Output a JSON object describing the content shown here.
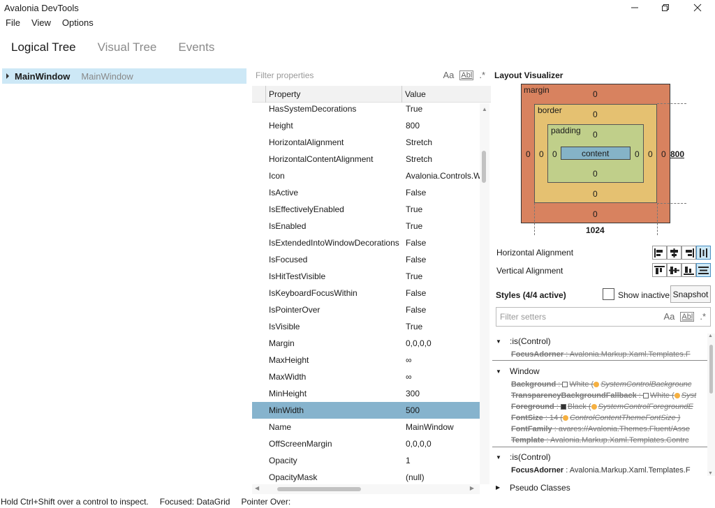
{
  "window": {
    "title": "Avalonia DevTools"
  },
  "menu": [
    "File",
    "View",
    "Options"
  ],
  "tabs": [
    "Logical Tree",
    "Visual Tree",
    "Events"
  ],
  "tree": {
    "node_name": "MainWindow",
    "node_type": "MainWindow"
  },
  "props": {
    "filter_placeholder": "Filter properties",
    "col_property": "Property",
    "col_value": "Value",
    "icon_case": "Aa",
    "icon_word": "Abl",
    "icon_regex": ".*",
    "rows": [
      {
        "name": "HasSystemDecorations",
        "value": "True"
      },
      {
        "name": "Height",
        "value": "800"
      },
      {
        "name": "HorizontalAlignment",
        "value": "Stretch"
      },
      {
        "name": "HorizontalContentAlignment",
        "value": "Stretch"
      },
      {
        "name": "Icon",
        "value": "Avalonia.Controls.W"
      },
      {
        "name": "IsActive",
        "value": "False"
      },
      {
        "name": "IsEffectivelyEnabled",
        "value": "True"
      },
      {
        "name": "IsEnabled",
        "value": "True"
      },
      {
        "name": "IsExtendedIntoWindowDecorations",
        "value": "False"
      },
      {
        "name": "IsFocused",
        "value": "False"
      },
      {
        "name": "IsHitTestVisible",
        "value": "True"
      },
      {
        "name": "IsKeyboardFocusWithin",
        "value": "False"
      },
      {
        "name": "IsPointerOver",
        "value": "False"
      },
      {
        "name": "IsVisible",
        "value": "True"
      },
      {
        "name": "Margin",
        "value": "0,0,0,0"
      },
      {
        "name": "MaxHeight",
        "value": "∞"
      },
      {
        "name": "MaxWidth",
        "value": "∞"
      },
      {
        "name": "MinHeight",
        "value": "300"
      },
      {
        "name": "MinWidth",
        "value": "500",
        "selected": true
      },
      {
        "name": "Name",
        "value": "MainWindow"
      },
      {
        "name": "OffScreenMargin",
        "value": "0,0,0,0"
      },
      {
        "name": "Opacity",
        "value": "1"
      },
      {
        "name": "OpacityMask",
        "value": "(null)"
      }
    ]
  },
  "layout": {
    "title": "Layout Visualizer",
    "margin_label": "margin",
    "border_label": "border",
    "padding_label": "padding",
    "content_label": "content",
    "margin": {
      "top": "0",
      "right": "0",
      "bottom": "0",
      "left": "0"
    },
    "border": {
      "top": "0",
      "right": "0",
      "bottom": "0",
      "left": "0"
    },
    "padding": {
      "top": "0",
      "right": "0",
      "bottom": "0",
      "left": "0"
    },
    "height": "800",
    "width": "1024",
    "horizontal_alignment_label": "Horizontal Alignment",
    "vertical_alignment_label": "Vertical Alignment",
    "horizontal_alignment_selected": "stretch",
    "vertical_alignment_selected": "stretch"
  },
  "styles": {
    "title": "Styles (4/4 active)",
    "show_inactive_label": "Show inactive",
    "snapshot_label": "Snapshot",
    "filter_placeholder": "Filter setters",
    "groups": [
      {
        "selector": ":is(Control)",
        "setters": [
          {
            "prop": "FocusAdorner",
            "value": "Avalonia.Markup.Xaml.Templates.F"
          }
        ]
      },
      {
        "selector": "Window",
        "setters": [
          {
            "prop": "Background",
            "value": "White (",
            "resource": "SystemControlBackgrounc"
          },
          {
            "prop": "TransparencyBackgroundFallback",
            "value": "White (",
            "resource": "Syst"
          },
          {
            "prop": "Foreground",
            "value": "Black (",
            "resource": "SystemControlForegroundE"
          },
          {
            "prop": "FontSize",
            "value": "14 (",
            "resource": "ControlContentThemeFontSize )"
          },
          {
            "prop": "FontFamily",
            "value": "avares://Avalonia.Themes.Fluent/Asse"
          },
          {
            "prop": "Template",
            "value": "Avalonia.Markup.Xaml.Templates.Contrc"
          }
        ]
      },
      {
        "selector": ":is(Control)",
        "setters": [
          {
            "prop": "FocusAdorner",
            "value": "Avalonia.Markup.Xaml.Templates.F"
          }
        ]
      }
    ],
    "pseudo_classes_label": "Pseudo Classes"
  },
  "status": {
    "hint": "Hold Ctrl+Shift over a control to inspect.",
    "focused": "Focused: DataGrid",
    "pointer_over": "Pointer Over:"
  }
}
